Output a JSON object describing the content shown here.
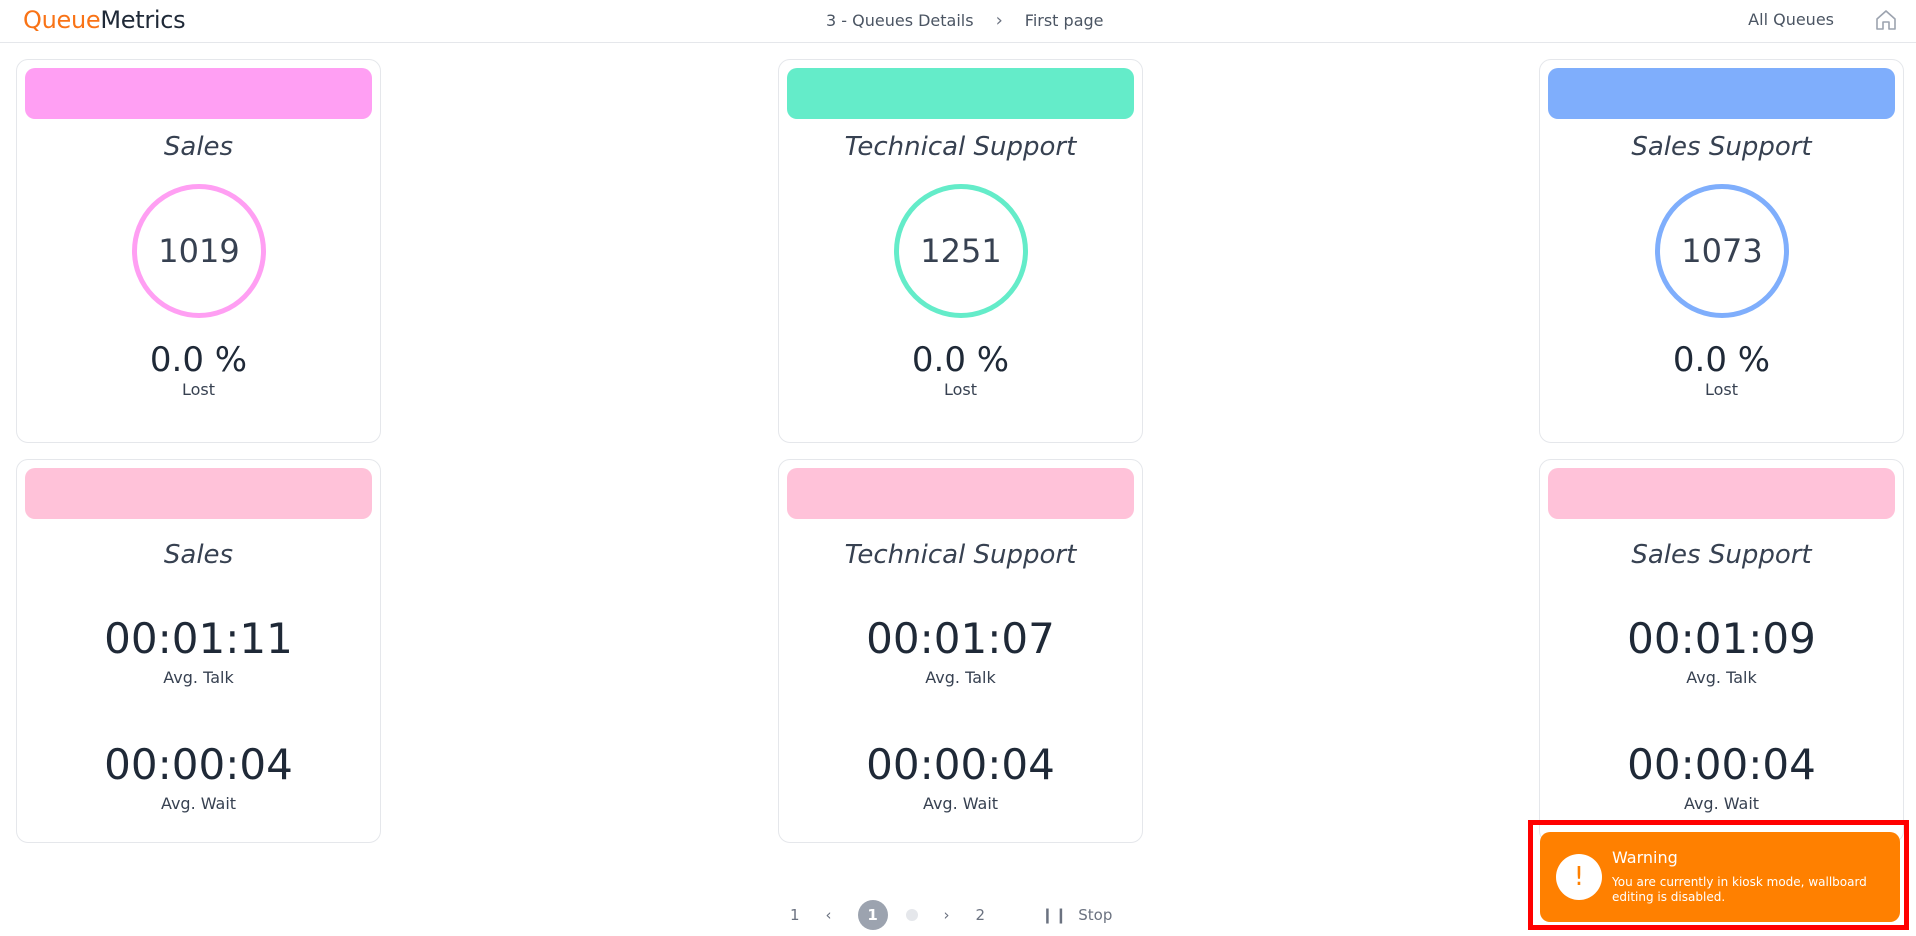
{
  "header": {
    "logo_part1": "Queue",
    "logo_part2": "Metrics",
    "breadcrumb_1": "3 - Queues Details",
    "breadcrumb_sep": "›",
    "breadcrumb_2": "First page",
    "all_queues": "All Queues",
    "home_icon": "home-icon"
  },
  "colors": {
    "sales": "#ff9ff3",
    "technical_support": "#64ecc9",
    "sales_support": "#7faefc",
    "wait_bar": "#ffc2d9",
    "accent": "#f97316",
    "toast": "#ff8000"
  },
  "lost_cards": [
    {
      "name": "Sales",
      "count": "1019",
      "percent": "0.0 %",
      "label": "Lost"
    },
    {
      "name": "Technical Support",
      "count": "1251",
      "percent": "0.0 %",
      "label": "Lost"
    },
    {
      "name": "Sales Support",
      "count": "1073",
      "percent": "0.0 %",
      "label": "Lost"
    }
  ],
  "time_cards": [
    {
      "name": "Sales",
      "avg_talk": "00:01:11",
      "talk_label": "Avg. Talk",
      "avg_wait": "00:00:04",
      "wait_label": "Avg. Wait"
    },
    {
      "name": "Technical Support",
      "avg_talk": "00:01:07",
      "talk_label": "Avg. Talk",
      "avg_wait": "00:00:04",
      "wait_label": "Avg. Wait"
    },
    {
      "name": "Sales Support",
      "avg_talk": "00:01:09",
      "talk_label": "Avg. Talk",
      "avg_wait": "00:00:04",
      "wait_label": "Avg. Wait"
    }
  ],
  "pager": {
    "first": "1",
    "prev": "‹",
    "current": "1",
    "next": "›",
    "last": "2",
    "stop_icon": "❙❙",
    "stop_label": "Stop"
  },
  "toast": {
    "icon": "!",
    "title": "Warning",
    "message": "You are currently in kiosk mode, wallboard editing is disabled."
  }
}
